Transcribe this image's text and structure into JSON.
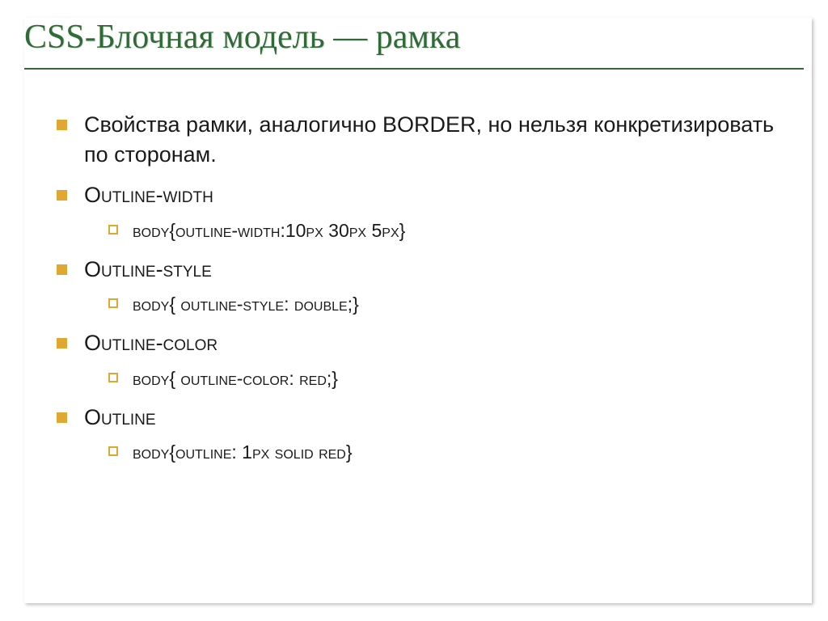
{
  "title": "CSS-Блочная модель — рамка",
  "bullets": [
    {
      "text": "Свойства рамки, аналогично BORDER, но нельзя конкретизировать по сторонам.",
      "sub": []
    },
    {
      "text": "Outline-width",
      "sub": [
        "body{outline-width:10px 30px 5px}"
      ]
    },
    {
      "text": "Outline-style",
      "sub": [
        "body{ outline-style: double;}"
      ]
    },
    {
      "text": "Outline-color",
      "sub": [
        "body{ outline-color: red;}"
      ]
    },
    {
      "text": "Outline",
      "sub": [
        "body{outline: 1px solid red}"
      ]
    }
  ]
}
